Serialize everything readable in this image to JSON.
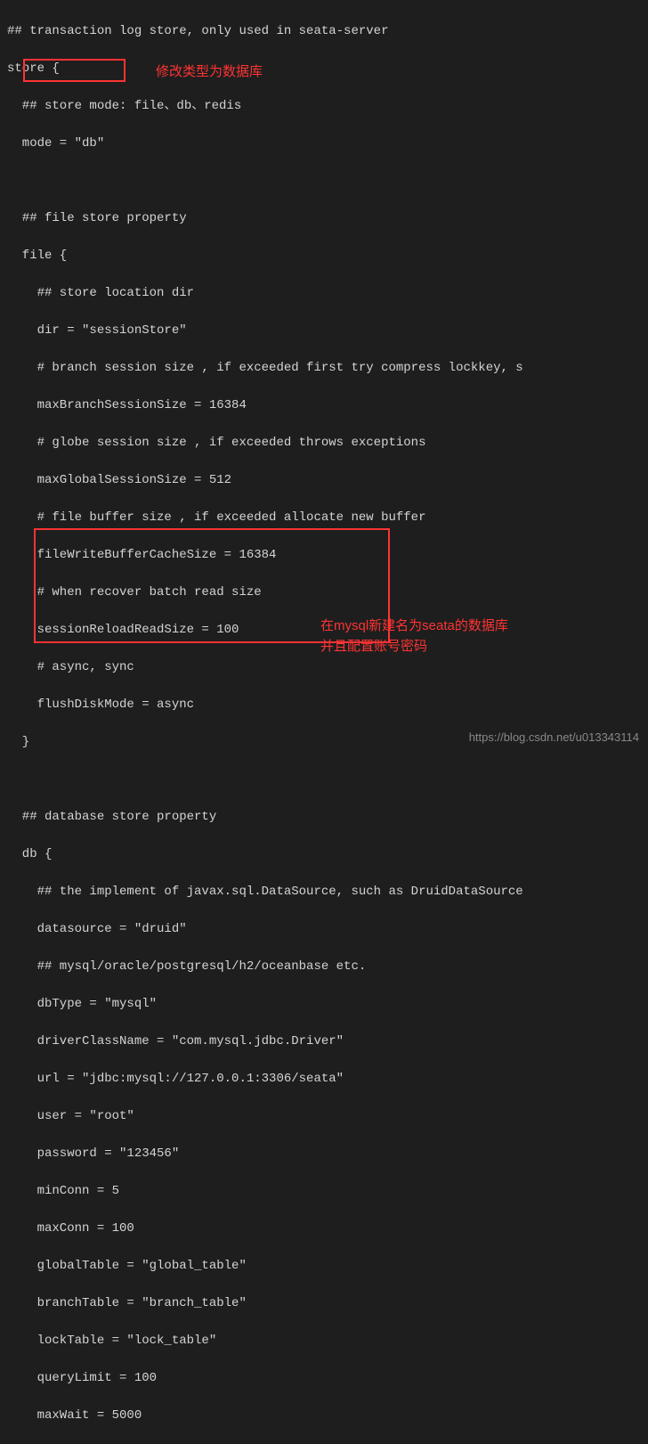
{
  "lines": {
    "l1": "## transaction log store, only used in seata-server",
    "l2": "store {",
    "l3": "  ## store mode: file、db、redis",
    "l4": "  mode = \"db\"",
    "l5": "",
    "l6": "  ## file store property",
    "l7": "  file {",
    "l8": "    ## store location dir",
    "l9": "    dir = \"sessionStore\"",
    "l10": "    # branch session size , if exceeded first try compress lockkey, s",
    "l11": "    maxBranchSessionSize = 16384",
    "l12": "    # globe session size , if exceeded throws exceptions",
    "l13": "    maxGlobalSessionSize = 512",
    "l14": "    # file buffer size , if exceeded allocate new buffer",
    "l15": "    fileWriteBufferCacheSize = 16384",
    "l16": "    # when recover batch read size",
    "l17": "    sessionReloadReadSize = 100",
    "l18": "    # async, sync",
    "l19": "    flushDiskMode = async",
    "l20": "  }",
    "l21": "",
    "l22": "  ## database store property",
    "l23": "  db {",
    "l24": "    ## the implement of javax.sql.DataSource, such as DruidDataSource",
    "l25": "    datasource = \"druid\"",
    "l26": "    ## mysql/oracle/postgresql/h2/oceanbase etc.",
    "l27": "    dbType = \"mysql\"",
    "l28": "    driverClassName = \"com.mysql.jdbc.Driver\"",
    "l29": "    url = \"jdbc:mysql://127.0.0.1:3306/seata\"",
    "l30": "    user = \"root\"",
    "l31": "    password = \"123456\"",
    "l32": "    minConn = 5",
    "l33": "    maxConn = 100",
    "l34": "    globalTable = \"global_table\"",
    "l35": "    branchTable = \"branch_table\"",
    "l36": "    lockTable = \"lock_table\"",
    "l37": "    queryLimit = 100",
    "l38": "    maxWait = 5000"
  },
  "annotations": {
    "a1": "修改类型为数据库",
    "a2": "在mysql新建名为seata的数据库",
    "a3": "并且配置账号密码"
  },
  "watermark": "https://blog.csdn.net/u013343114"
}
